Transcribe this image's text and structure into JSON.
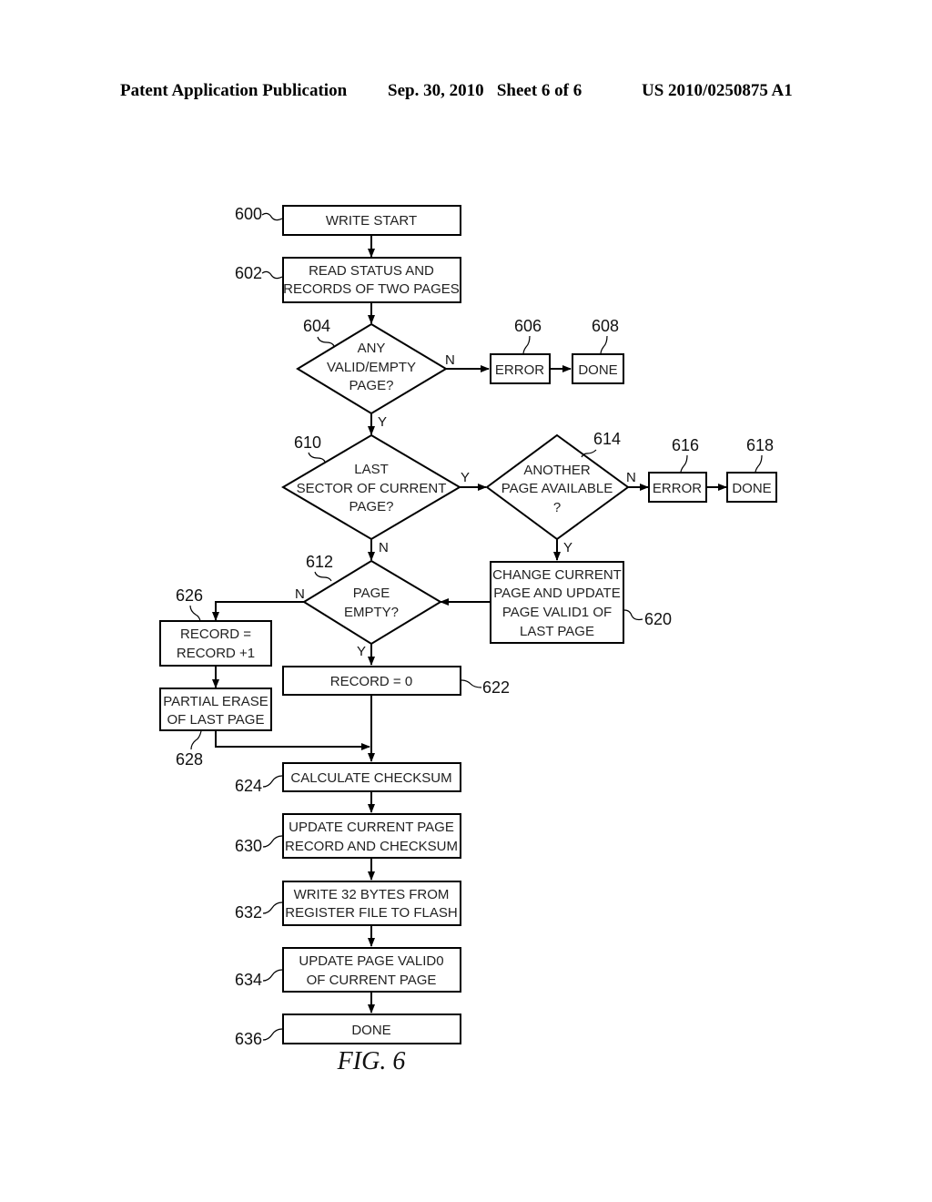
{
  "header": {
    "publication": "Patent Application Publication",
    "date_sheet": "Sep. 30, 2010   Sheet 6 of 6",
    "number": "US 2010/0250875 A1"
  },
  "figure_label": "FIG. 6",
  "nodes": {
    "n600": {
      "ref": "600",
      "lines": [
        "WRITE START"
      ]
    },
    "n602": {
      "ref": "602",
      "lines": [
        "READ STATUS AND",
        "RECORDS OF TWO PAGES"
      ]
    },
    "n604": {
      "ref": "604",
      "lines": [
        "ANY",
        "VALID/EMPTY",
        "PAGE?"
      ]
    },
    "n606": {
      "ref": "606",
      "lines": [
        "ERROR"
      ]
    },
    "n608": {
      "ref": "608",
      "lines": [
        "DONE"
      ]
    },
    "n610": {
      "ref": "610",
      "lines": [
        "LAST",
        "SECTOR OF CURRENT",
        "PAGE?"
      ]
    },
    "n614": {
      "ref": "614",
      "lines": [
        "ANOTHER",
        "PAGE AVAILABLE",
        "?"
      ]
    },
    "n616": {
      "ref": "616",
      "lines": [
        "ERROR"
      ]
    },
    "n618": {
      "ref": "618",
      "lines": [
        "DONE"
      ]
    },
    "n612": {
      "ref": "612",
      "lines": [
        "PAGE",
        "EMPTY?"
      ]
    },
    "n620": {
      "ref": "620",
      "lines": [
        "CHANGE CURRENT",
        "PAGE AND UPDATE",
        "PAGE VALID1 OF",
        "LAST PAGE"
      ]
    },
    "n626": {
      "ref": "626",
      "lines": [
        "RECORD =",
        "RECORD +1"
      ]
    },
    "n628": {
      "ref": "628",
      "lines": [
        "PARTIAL ERASE",
        "OF LAST PAGE"
      ]
    },
    "n622": {
      "ref": "622",
      "lines": [
        "RECORD = 0"
      ]
    },
    "n624": {
      "ref": "624",
      "lines": [
        "CALCULATE CHECKSUM"
      ]
    },
    "n630": {
      "ref": "630",
      "lines": [
        "UPDATE CURRENT PAGE",
        "RECORD AND CHECKSUM"
      ]
    },
    "n632": {
      "ref": "632",
      "lines": [
        "WRITE 32 BYTES FROM",
        "REGISTER FILE TO FLASH"
      ]
    },
    "n634": {
      "ref": "634",
      "lines": [
        "UPDATE PAGE VALID0",
        "OF CURRENT PAGE"
      ]
    },
    "n636": {
      "ref": "636",
      "lines": [
        "DONE"
      ]
    }
  },
  "edge_labels": {
    "e604_n": "N",
    "e604_y": "Y",
    "e610_y": "Y",
    "e610_n": "N",
    "e614_n": "N",
    "e614_y": "Y",
    "e612_n": "N",
    "e612_y": "Y"
  }
}
